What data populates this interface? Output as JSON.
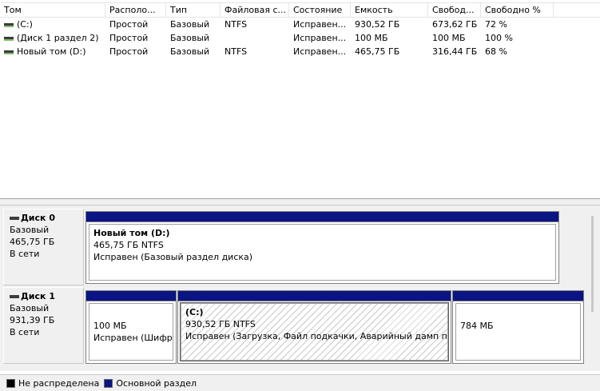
{
  "columns": [
    "Том",
    "Располо...",
    "Тип",
    "Файловая с...",
    "Состояние",
    "Емкость",
    "Свобод...",
    "Свободно %"
  ],
  "volumes": [
    {
      "name": "(C:)",
      "layout": "Простой",
      "type": "Базовый",
      "fs": "NTFS",
      "status": "Исправен...",
      "capacity": "930,52 ГБ",
      "free": "673,62 ГБ",
      "free_pct": "72 %"
    },
    {
      "name": "(Диск 1 раздел 2)",
      "layout": "Простой",
      "type": "Базовый",
      "fs": "",
      "status": "Исправен...",
      "capacity": "100 МБ",
      "free": "100 МБ",
      "free_pct": "100 %"
    },
    {
      "name": "Новый том (D:)",
      "layout": "Простой",
      "type": "Базовый",
      "fs": "NTFS",
      "status": "Исправен...",
      "capacity": "465,75 ГБ",
      "free": "316,44 ГБ",
      "free_pct": "68 %"
    }
  ],
  "disks": [
    {
      "title": "Диск 0",
      "type": "Базовый",
      "size": "465,75 ГБ",
      "state": "В сети",
      "partitions": [
        {
          "name": "Новый том  (D:)",
          "size": "465,75 ГБ NTFS",
          "status": "Исправен (Базовый раздел диска)"
        }
      ]
    },
    {
      "title": "Диск 1",
      "type": "Базовый",
      "size": "931,39 ГБ",
      "state": "В сети",
      "partitions": [
        {
          "name": "",
          "size": "100 МБ",
          "status": "Исправен (Шифро"
        },
        {
          "name": "(C:)",
          "size": "930,52 ГБ NTFS",
          "status": "Исправен (Загрузка, Файл подкачки, Аварийный дамп пам"
        },
        {
          "name": "",
          "size": "784 МБ",
          "status": ""
        }
      ]
    }
  ],
  "legend": {
    "unallocated": "Не распределена",
    "primary": "Основной раздел",
    "unallocated_color": "#000000",
    "primary_color": "#0a1483"
  }
}
